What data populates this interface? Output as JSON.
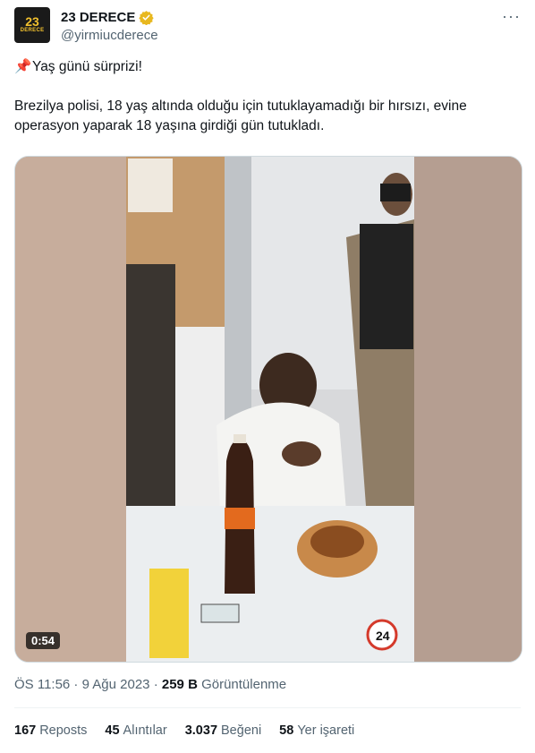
{
  "author": {
    "avatar_text_top": "23",
    "avatar_text_bottom": "DERECE",
    "display_name": "23 DERECE",
    "handle": "@yirmiucderece",
    "verified_color": "#e8b81f"
  },
  "more_menu": "···",
  "tweet": {
    "pin_icon": "📌",
    "line1": "Yaş günü sürprizi!",
    "body": "Brezilya polisi, 18 yaş altında olduğu için tutuklayamadığı bir hırsızı, evine operasyon yaparak 18 yaşına girdiği gün tutukladı."
  },
  "video": {
    "duration": "0:54",
    "watermark": "24"
  },
  "meta": {
    "time": "ÖS 11:56",
    "sep1": " · ",
    "date": "9 Ağu 2023",
    "sep2": " · ",
    "views_count": "259 B",
    "views_label": " Görüntülenme"
  },
  "stats": [
    {
      "count": "167",
      "label": "Reposts"
    },
    {
      "count": "45",
      "label": "Alıntılar"
    },
    {
      "count": "3.037",
      "label": "Beğeni"
    },
    {
      "count": "58",
      "label": "Yer işareti"
    }
  ]
}
